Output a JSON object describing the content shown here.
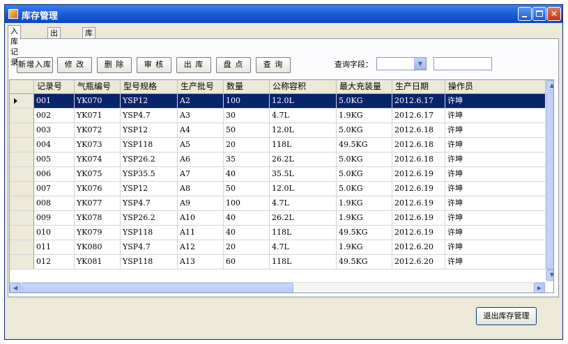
{
  "window": {
    "title": "库存管理"
  },
  "tabs": [
    {
      "label": "入库记录",
      "active": true
    },
    {
      "label": "出库记录",
      "active": false
    },
    {
      "label": "库存盘点",
      "active": false
    }
  ],
  "toolbar": {
    "buttons": [
      "新增入库",
      "修 改",
      "删 除",
      "审 核",
      "出 库",
      "盘 点",
      "查 询"
    ],
    "query_label": "查询字段：",
    "query_select_value": "",
    "query_input_value": ""
  },
  "grid": {
    "columns": [
      "记录号",
      "气瓶编号",
      "型号规格",
      "生产批号",
      "数量",
      "公称容积",
      "最大充装量",
      "生产日期",
      "操作员"
    ],
    "selected_row": 0,
    "rows": [
      [
        "001",
        "YK070",
        "YSP12",
        "A2",
        "100",
        "12.0L",
        "5.0KG",
        "2012.6.17",
        "许坤"
      ],
      [
        "002",
        "YK071",
        "YSP4.7",
        "A3",
        "30",
        "4.7L",
        "1.9KG",
        "2012.6.17",
        "许坤"
      ],
      [
        "003",
        "YK072",
        "YSP12",
        "A4",
        "50",
        "12.0L",
        "5.0KG",
        "2012.6.18",
        "许坤"
      ],
      [
        "004",
        "YK073",
        "YSP118",
        "A5",
        "20",
        "118L",
        "49.5KG",
        "2012.6.18",
        "许坤"
      ],
      [
        "005",
        "YK074",
        "YSP26.2",
        "A6",
        "35",
        "26.2L",
        "5.0KG",
        "2012.6.18",
        "许坤"
      ],
      [
        "006",
        "YK075",
        "YSP35.5",
        "A7",
        "40",
        "35.5L",
        "5.0KG",
        "2012.6.19",
        "许坤"
      ],
      [
        "007",
        "YK076",
        "YSP12",
        "A8",
        "50",
        "12.0L",
        "5.0KG",
        "2012.6.19",
        "许坤"
      ],
      [
        "008",
        "YK077",
        "YSP4.7",
        "A9",
        "100",
        "4.7L",
        "1.9KG",
        "2012.6.19",
        "许坤"
      ],
      [
        "009",
        "YK078",
        "YSP26.2",
        "A10",
        "40",
        "26.2L",
        "1.9KG",
        "2012.6.19",
        "许坤"
      ],
      [
        "010",
        "YK079",
        "YSP118",
        "A11",
        "40",
        "118L",
        "49.5KG",
        "2012.6.19",
        "许坤"
      ],
      [
        "011",
        "YK080",
        "YSP4.7",
        "A12",
        "20",
        "4.7L",
        "1.9KG",
        "2012.6.20",
        "许坤"
      ],
      [
        "012",
        "YK081",
        "YSP118",
        "A13",
        "60",
        "118L",
        "49.5KG",
        "2012.6.20",
        "许坤"
      ]
    ]
  },
  "footer": {
    "exit_label": "退出库存管理"
  },
  "colors": {
    "titlebar": "#0b46c2",
    "selection": "#0a246a",
    "window_bg": "#ece9d8"
  }
}
